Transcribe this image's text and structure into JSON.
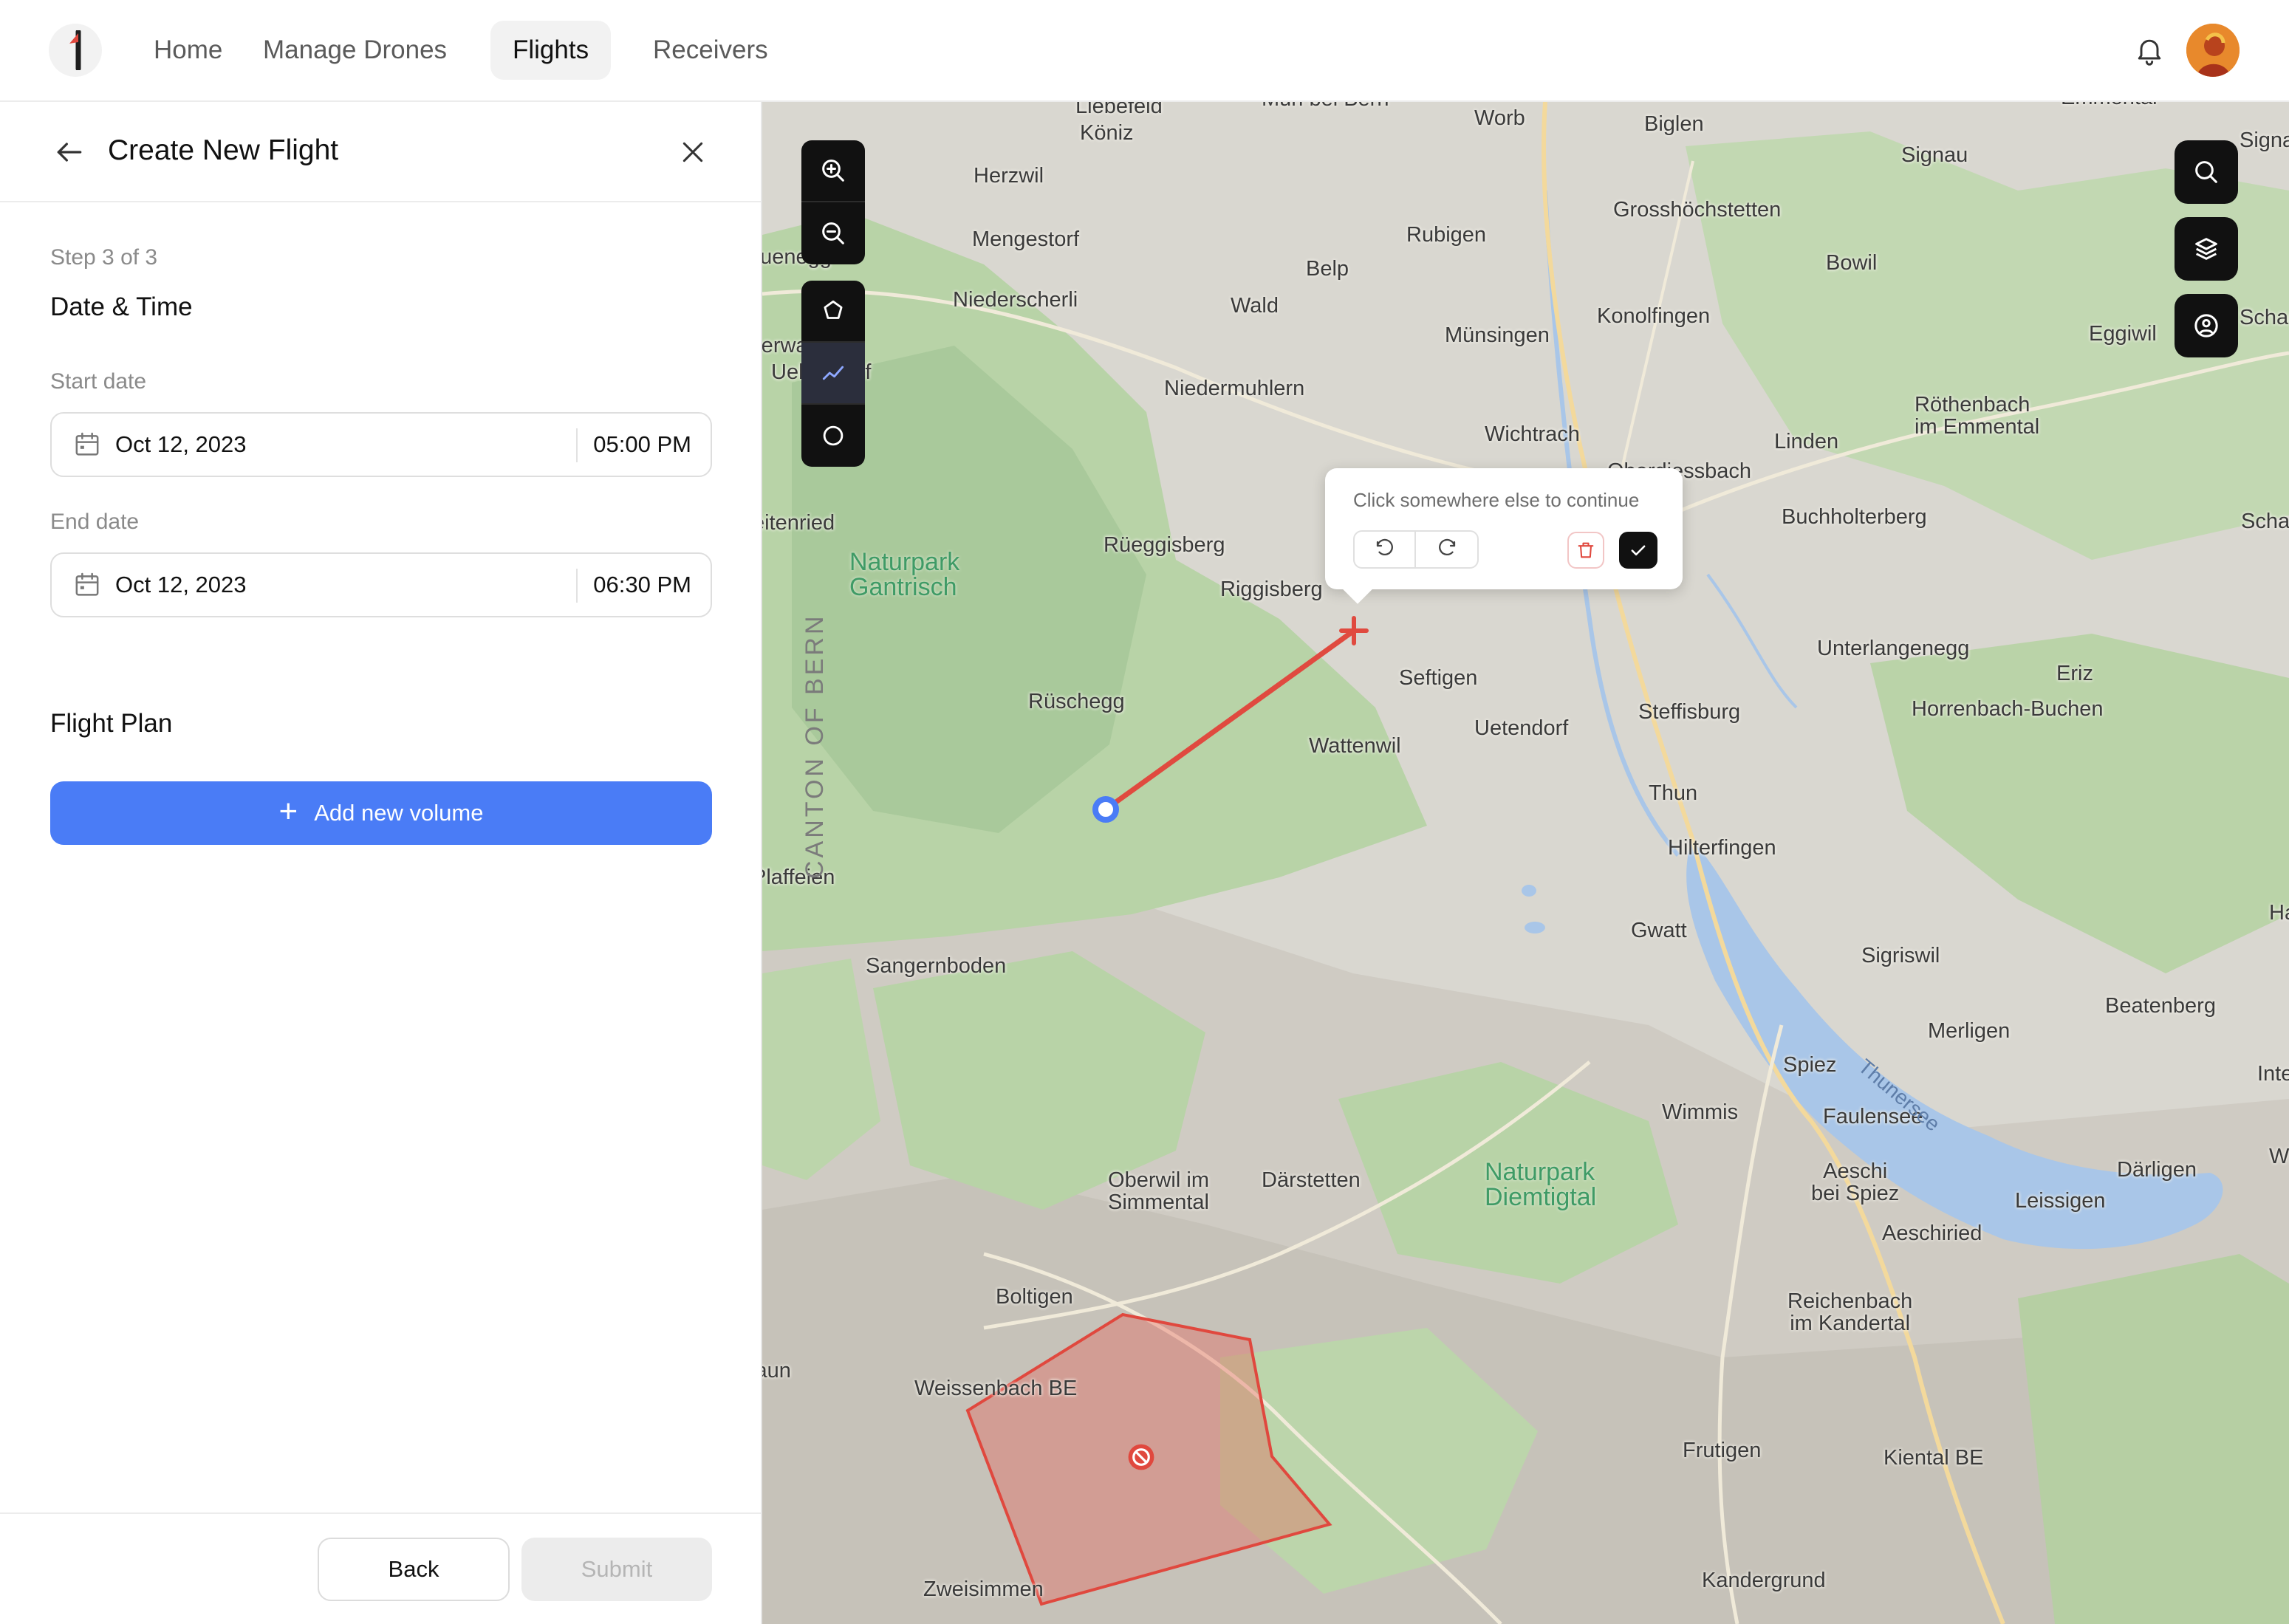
{
  "nav": {
    "items": [
      {
        "label": "Home"
      },
      {
        "label": "Manage Drones"
      },
      {
        "label": "Flights"
      },
      {
        "label": "Receivers"
      }
    ],
    "active": "Flights"
  },
  "panel": {
    "title": "Create New Flight",
    "step": "Step 3 of 3",
    "section": "Date & Time",
    "start_label": "Start date",
    "start_date": "Oct 12, 2023",
    "start_time": "05:00 PM",
    "end_label": "End date",
    "end_date": "Oct 12, 2023",
    "end_time": "06:30 PM",
    "flight_plan": "Flight Plan",
    "add_volume": "Add new volume",
    "back": "Back",
    "submit": "Submit"
  },
  "map": {
    "popup_hint": "Click somewhere else to continue",
    "canton": "CANTON OF BERN",
    "lake": "Thunersee",
    "parks": [
      {
        "name": "Naturpark\nGantrisch"
      },
      {
        "name": "Naturpark\nDiemtigtal"
      }
    ],
    "places": [
      "Liebefeld",
      "Köniz",
      "Muri bei Bern",
      "Worb",
      "Biglen",
      "Emmental",
      "Signau",
      "Herzwil",
      "Mengestorf",
      "Neuenegg",
      "Rubigen",
      "Grosshöchstetten",
      "Belp",
      "Bowil",
      "Niederscherli",
      "Wald",
      "Konolfingen",
      "Münsingen",
      "Eggiwil",
      "Niedermuhlern",
      "Röthenbach\nim Emmental",
      "Wichtrach",
      "Linden",
      "Oberdiessbach",
      "Buchholterberg",
      "Schangnau",
      "Rüeggisberg",
      "Riggisberg",
      "Oberwangen",
      "Ueberstorf",
      "Heitenried",
      "Unterlangenegg",
      "Eriz",
      "Horrenbach-Buchen",
      "Seftigen",
      "Rüschegg",
      "Steffisburg",
      "Uetendorf",
      "Wattenwil",
      "Thun",
      "Hilterfingen",
      "Plaffeien",
      "Gwatt",
      "Sigriswil",
      "Sangernboden",
      "Beatenberg",
      "Merligen",
      "Spiez",
      "Wimmis",
      "Faulensee",
      "Interlaken",
      "Oberwil im\nSimmental",
      "Därstetten",
      "Aeschi\nbei Spiez",
      "Därligen",
      "Leissigen",
      "Aeschiried",
      "Boltigen",
      "Reichenbach\nim Kandertal",
      "Weissenbach BE",
      "Frutigen",
      "Kiental BE",
      "Zweisimmen",
      "Kandergrund",
      "Jaun",
      "Habkern",
      "Wilderswil",
      "Signau",
      "Schachen"
    ]
  },
  "colors": {
    "accent": "#4a7cf6",
    "route": "#e04a3f",
    "no_fly_zone": "#e0483e",
    "nav_active_bg": "#f2f2f2",
    "map_bg": "#d9d7d0",
    "forest": "#b8d3a7",
    "lake": "#a9c6e8"
  },
  "icons": [
    "back-arrow-icon",
    "close-icon",
    "calendar-icon",
    "plus-icon",
    "zoom-in-icon",
    "zoom-out-icon",
    "polygon-icon",
    "polyline-icon",
    "circle-icon",
    "search-icon",
    "layers-icon",
    "location-pin-icon",
    "undo-icon",
    "redo-icon",
    "trash-icon",
    "check-icon",
    "bell-icon",
    "no-entry-icon"
  ]
}
